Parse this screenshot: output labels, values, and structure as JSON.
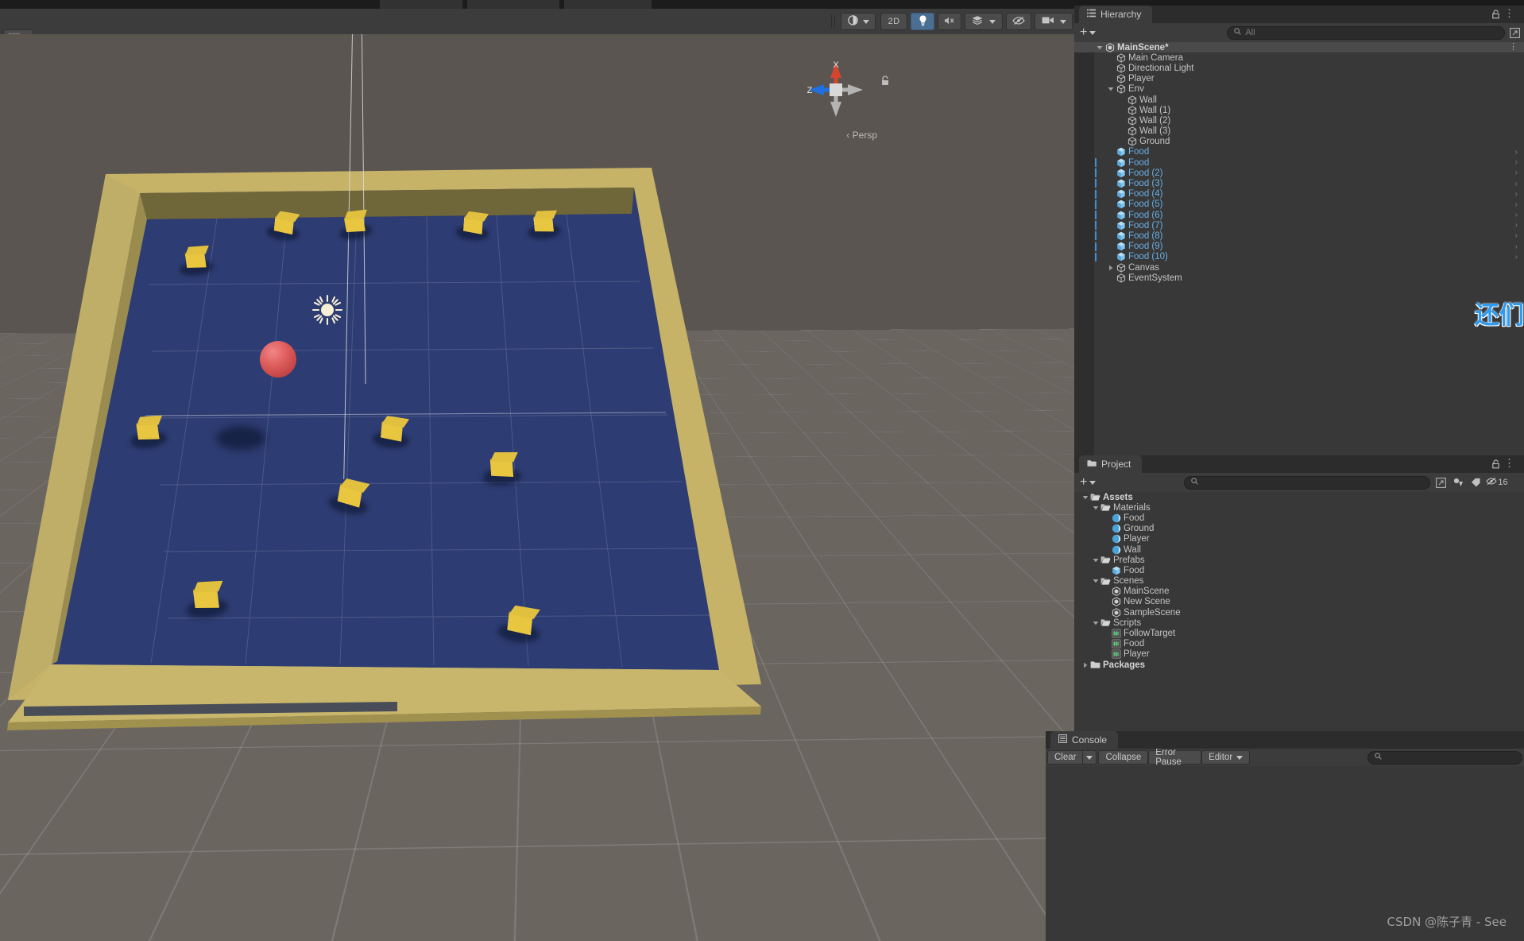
{
  "app": {
    "name": "Unity Editor",
    "watermark": "CSDN @陈子青 - See"
  },
  "scene_toolbar": {
    "handle_tool": "pivot-rotation-toggle",
    "buttons": [
      {
        "name": "draw-mode-dropdown",
        "label": "",
        "icon": "shaded-sphere-icon",
        "active": false
      },
      {
        "name": "2d-toggle",
        "label": "2D",
        "icon": "",
        "active": false
      },
      {
        "name": "scene-lighting-toggle",
        "label": "",
        "icon": "lightbulb-icon",
        "active": true
      },
      {
        "name": "scene-audio-toggle",
        "label": "",
        "icon": "speaker-mute-icon",
        "active": false
      },
      {
        "name": "fx-dropdown",
        "label": "",
        "icon": "effects-icon",
        "active": false
      },
      {
        "name": "scene-visibility-toggle",
        "label": "",
        "icon": "eye-off-icon",
        "active": false
      },
      {
        "name": "camera-settings",
        "label": "",
        "icon": "camera-icon",
        "active": false
      },
      {
        "name": "gizmos-toggle",
        "label": "",
        "icon": "gizmos-globe-icon",
        "active": true
      }
    ]
  },
  "scene_view": {
    "gizmo": {
      "x_label": "X",
      "z_label": "Z",
      "projection": "Persp",
      "back_label": "‹"
    },
    "objects": {
      "player_sphere": "Player",
      "light_gizmo": "Directional Light",
      "food_cubes_count": 11,
      "ground": "Ground",
      "walls": 4
    }
  },
  "hierarchy": {
    "tab_label": "Hierarchy",
    "tab_icon": "hierarchy-icon",
    "add_label": "+",
    "search_placeholder": "All",
    "lock_icon": "lock-icon",
    "menu_icon": "kebab-menu-icon",
    "items": [
      {
        "label": "MainScene*",
        "depth": 0,
        "icon": "unity-scene-icon",
        "twisty": "down",
        "selected": true,
        "blue": false,
        "bold": true,
        "chev": false,
        "marker": false
      },
      {
        "label": "Main Camera",
        "depth": 1,
        "icon": "gameobject-icon",
        "twisty": "",
        "selected": false,
        "blue": false,
        "bold": false,
        "chev": false,
        "marker": false
      },
      {
        "label": "Directional Light",
        "depth": 1,
        "icon": "gameobject-icon",
        "twisty": "",
        "selected": false,
        "blue": false,
        "bold": false,
        "chev": false,
        "marker": false
      },
      {
        "label": "Player",
        "depth": 1,
        "icon": "gameobject-icon",
        "twisty": "",
        "selected": false,
        "blue": false,
        "bold": false,
        "chev": false,
        "marker": false
      },
      {
        "label": "Env",
        "depth": 1,
        "icon": "gameobject-icon",
        "twisty": "down",
        "selected": false,
        "blue": false,
        "bold": false,
        "chev": false,
        "marker": false
      },
      {
        "label": "Wall",
        "depth": 2,
        "icon": "gameobject-icon",
        "twisty": "",
        "selected": false,
        "blue": false,
        "bold": false,
        "chev": false,
        "marker": false
      },
      {
        "label": "Wall (1)",
        "depth": 2,
        "icon": "gameobject-icon",
        "twisty": "",
        "selected": false,
        "blue": false,
        "bold": false,
        "chev": false,
        "marker": false
      },
      {
        "label": "Wall (2)",
        "depth": 2,
        "icon": "gameobject-icon",
        "twisty": "",
        "selected": false,
        "blue": false,
        "bold": false,
        "chev": false,
        "marker": false
      },
      {
        "label": "Wall (3)",
        "depth": 2,
        "icon": "gameobject-icon",
        "twisty": "",
        "selected": false,
        "blue": false,
        "bold": false,
        "chev": false,
        "marker": false
      },
      {
        "label": "Ground",
        "depth": 2,
        "icon": "gameobject-icon",
        "twisty": "",
        "selected": false,
        "blue": false,
        "bold": false,
        "chev": false,
        "marker": false
      },
      {
        "label": "Food",
        "depth": 1,
        "icon": "prefab-icon",
        "twisty": "",
        "selected": false,
        "blue": true,
        "bold": false,
        "chev": true,
        "marker": false
      },
      {
        "label": "Food",
        "depth": 1,
        "icon": "prefab-icon",
        "twisty": "",
        "selected": false,
        "blue": true,
        "bold": false,
        "chev": true,
        "marker": true
      },
      {
        "label": "Food (2)",
        "depth": 1,
        "icon": "prefab-icon",
        "twisty": "",
        "selected": false,
        "blue": true,
        "bold": false,
        "chev": true,
        "marker": true
      },
      {
        "label": "Food (3)",
        "depth": 1,
        "icon": "prefab-icon",
        "twisty": "",
        "selected": false,
        "blue": true,
        "bold": false,
        "chev": true,
        "marker": true
      },
      {
        "label": "Food (4)",
        "depth": 1,
        "icon": "prefab-icon",
        "twisty": "",
        "selected": false,
        "blue": true,
        "bold": false,
        "chev": true,
        "marker": true
      },
      {
        "label": "Food (5)",
        "depth": 1,
        "icon": "prefab-icon",
        "twisty": "",
        "selected": false,
        "blue": true,
        "bold": false,
        "chev": true,
        "marker": true
      },
      {
        "label": "Food (6)",
        "depth": 1,
        "icon": "prefab-icon",
        "twisty": "",
        "selected": false,
        "blue": true,
        "bold": false,
        "chev": true,
        "marker": true
      },
      {
        "label": "Food (7)",
        "depth": 1,
        "icon": "prefab-icon",
        "twisty": "",
        "selected": false,
        "blue": true,
        "bold": false,
        "chev": true,
        "marker": true
      },
      {
        "label": "Food (8)",
        "depth": 1,
        "icon": "prefab-icon",
        "twisty": "",
        "selected": false,
        "blue": true,
        "bold": false,
        "chev": true,
        "marker": true
      },
      {
        "label": "Food (9)",
        "depth": 1,
        "icon": "prefab-icon",
        "twisty": "",
        "selected": false,
        "blue": true,
        "bold": false,
        "chev": true,
        "marker": true
      },
      {
        "label": "Food (10)",
        "depth": 1,
        "icon": "prefab-icon",
        "twisty": "",
        "selected": false,
        "blue": true,
        "bold": false,
        "chev": true,
        "marker": true
      },
      {
        "label": "Canvas",
        "depth": 1,
        "icon": "gameobject-icon",
        "twisty": "right",
        "selected": false,
        "blue": false,
        "bold": false,
        "chev": false,
        "marker": false
      },
      {
        "label": "EventSystem",
        "depth": 1,
        "icon": "gameobject-icon",
        "twisty": "",
        "selected": false,
        "blue": false,
        "bold": false,
        "chev": false,
        "marker": false
      }
    ],
    "overlay_text": "还们"
  },
  "project": {
    "tab_label": "Project",
    "tab_icon": "folder-icon",
    "add_label": "+",
    "search_placeholder": "",
    "toolbar_icons": [
      "expand-icon",
      "filter-type-icon",
      "filter-label-icon",
      "eye-off-icon"
    ],
    "visibility_count": "16",
    "items": [
      {
        "label": "Assets",
        "depth": 0,
        "icon": "folder-open-icon",
        "twisty": "down",
        "bold": true
      },
      {
        "label": "Materials",
        "depth": 1,
        "icon": "folder-open-icon",
        "twisty": "down",
        "bold": false
      },
      {
        "label": "Food",
        "depth": 2,
        "icon": "material-icon",
        "twisty": "",
        "bold": false
      },
      {
        "label": "Ground",
        "depth": 2,
        "icon": "material-icon",
        "twisty": "",
        "bold": false
      },
      {
        "label": "Player",
        "depth": 2,
        "icon": "material-icon",
        "twisty": "",
        "bold": false
      },
      {
        "label": "Wall",
        "depth": 2,
        "icon": "material-icon",
        "twisty": "",
        "bold": false
      },
      {
        "label": "Prefabs",
        "depth": 1,
        "icon": "folder-open-icon",
        "twisty": "down",
        "bold": false
      },
      {
        "label": "Food",
        "depth": 2,
        "icon": "prefab-icon",
        "twisty": "",
        "bold": false
      },
      {
        "label": "Scenes",
        "depth": 1,
        "icon": "folder-open-icon",
        "twisty": "down",
        "bold": false
      },
      {
        "label": "MainScene",
        "depth": 2,
        "icon": "unity-scene-icon",
        "twisty": "",
        "bold": false
      },
      {
        "label": "New Scene",
        "depth": 2,
        "icon": "unity-scene-icon",
        "twisty": "",
        "bold": false
      },
      {
        "label": "SampleScene",
        "depth": 2,
        "icon": "unity-scene-icon",
        "twisty": "",
        "bold": false
      },
      {
        "label": "Scripts",
        "depth": 1,
        "icon": "folder-open-icon",
        "twisty": "down",
        "bold": false
      },
      {
        "label": "FollowTarget",
        "depth": 2,
        "icon": "csharp-script-icon",
        "twisty": "",
        "bold": false
      },
      {
        "label": "Food",
        "depth": 2,
        "icon": "csharp-script-icon",
        "twisty": "",
        "bold": false
      },
      {
        "label": "Player",
        "depth": 2,
        "icon": "csharp-script-icon",
        "twisty": "",
        "bold": false
      },
      {
        "label": "Packages",
        "depth": 0,
        "icon": "folder-closed-icon",
        "twisty": "right",
        "bold": true
      }
    ]
  },
  "console": {
    "tab_label": "Console",
    "tab_icon": "console-icon",
    "clear_label": "Clear",
    "collapse_label": "Collapse",
    "error_pause_label": "Error Pause",
    "editor_label": "Editor",
    "search_placeholder": "",
    "messages": []
  }
}
